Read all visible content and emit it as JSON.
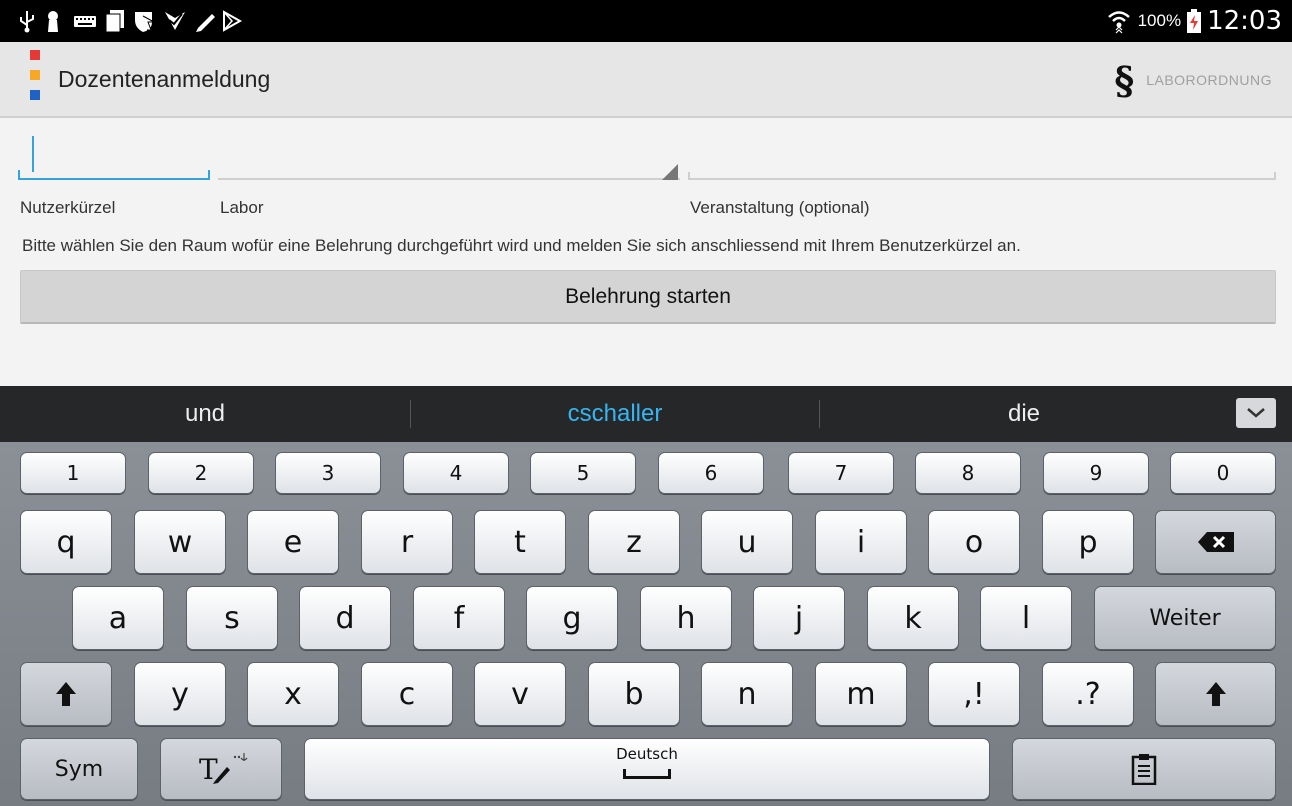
{
  "status_bar": {
    "left_icons": [
      "usb-icon",
      "keyhole-icon",
      "keyboard-icon",
      "document-icon",
      "shield-icon",
      "checkmark-icon",
      "pen-icon",
      "play-store-icon"
    ],
    "wifi_icon": "wifi-icon",
    "battery_percent": "100%",
    "battery_icon": "battery-charging-icon",
    "time": "12:03"
  },
  "action_bar": {
    "title": "Dozentenanmeldung",
    "logo_colors": [
      "#e53935",
      "#f9a825",
      "#1e63c4"
    ],
    "laborordnung_icon": "§",
    "laborordnung_label": "LABORORDNUNG"
  },
  "form": {
    "nutzer_value": "",
    "nutzer_label": "Nutzerkürzel",
    "labor_label": "Labor",
    "veranstaltung_label": "Veranstaltung (optional)",
    "instruction": "Bitte wählen Sie den Raum wofür eine Belehrung durchgeführt wird und melden Sie sich anschliessend mit Ihrem Benutzerkürzel an.",
    "start_button": "Belehrung starten",
    "accent_color": "#33a3dc"
  },
  "suggestions": {
    "items": [
      "und",
      "cschaller",
      "die"
    ],
    "highlight_color": "#37b5f0"
  },
  "keyboard": {
    "row_numbers": [
      "1",
      "2",
      "3",
      "4",
      "5",
      "6",
      "7",
      "8",
      "9",
      "0"
    ],
    "row1": [
      "q",
      "w",
      "e",
      "r",
      "t",
      "z",
      "u",
      "i",
      "o",
      "p"
    ],
    "row2": [
      "a",
      "s",
      "d",
      "f",
      "g",
      "h",
      "j",
      "k",
      "l"
    ],
    "enter_label": "Weiter",
    "row3": [
      "y",
      "x",
      "c",
      "v",
      "b",
      "n",
      "m"
    ],
    "comma_key": ",!",
    "period_key": ".?",
    "sym_label": "Sym",
    "space_label": "Deutsch"
  }
}
